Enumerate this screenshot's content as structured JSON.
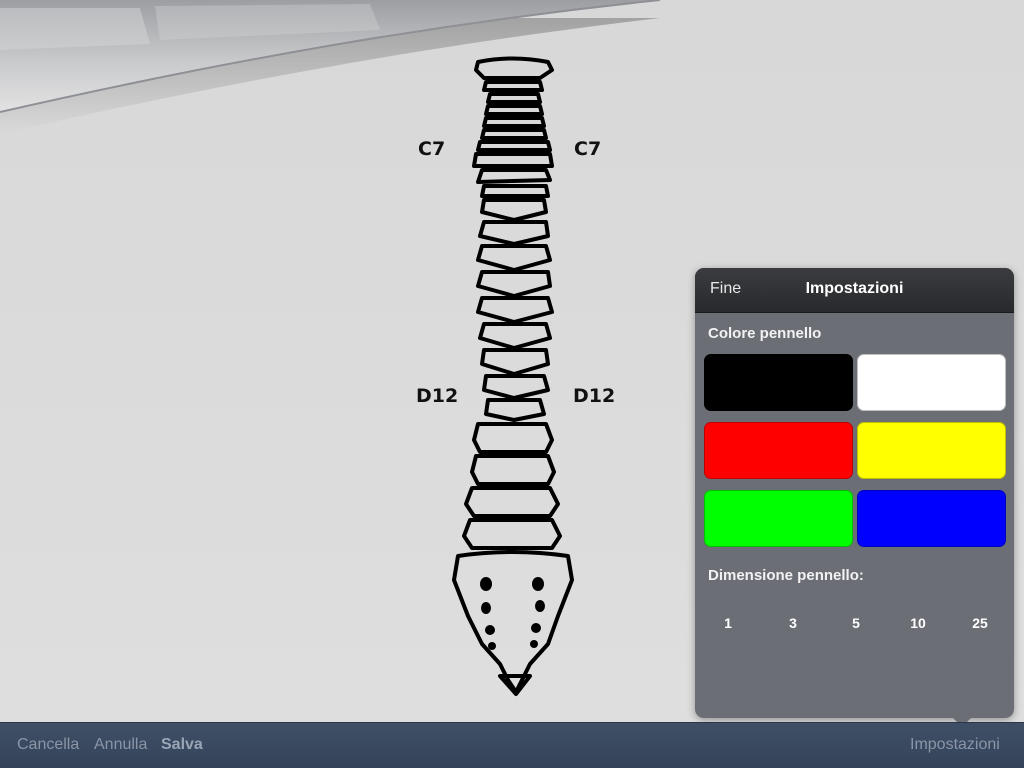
{
  "canvas": {
    "labels": {
      "top_left": "C7",
      "top_right": "C7",
      "mid_left": "D12",
      "mid_right": "D12"
    }
  },
  "settings_popover": {
    "done_label": "Fine",
    "title": "Impostazioni",
    "brush_color_label": "Colore pennello",
    "colors": [
      {
        "name": "black",
        "hex": "#000000"
      },
      {
        "name": "white",
        "hex": "#ffffff"
      },
      {
        "name": "red",
        "hex": "#ff0000"
      },
      {
        "name": "yellow",
        "hex": "#ffff00"
      },
      {
        "name": "green",
        "hex": "#00ff00"
      },
      {
        "name": "blue",
        "hex": "#0000ff"
      }
    ],
    "brush_size_label": "Dimensione pennello:",
    "sizes": [
      "1",
      "3",
      "5",
      "10",
      "25"
    ]
  },
  "toolbar": {
    "clear_label": "Cancella",
    "undo_label": "Annulla",
    "save_label": "Salva",
    "settings_label": "Impostazioni"
  }
}
